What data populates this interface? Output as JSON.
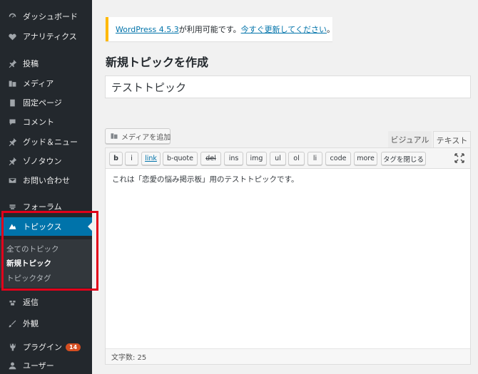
{
  "sidebar": {
    "items": [
      {
        "label": "ダッシュボード",
        "icon": "dashboard-icon"
      },
      {
        "label": "アナリティクス",
        "icon": "analytics-icon"
      },
      {
        "label": "投稿",
        "icon": "pin-icon"
      },
      {
        "label": "メディア",
        "icon": "media-icon"
      },
      {
        "label": "固定ページ",
        "icon": "page-icon"
      },
      {
        "label": "コメント",
        "icon": "comment-icon"
      },
      {
        "label": "グッド＆ニュー",
        "icon": "pin-icon"
      },
      {
        "label": "ゾノタウン",
        "icon": "pin-icon"
      },
      {
        "label": "お問い合わせ",
        "icon": "mail-icon"
      },
      {
        "label": "フォーラム",
        "icon": "forum-icon"
      },
      {
        "label": "トピックス",
        "icon": "topics-icon"
      },
      {
        "label": "返信",
        "icon": "reply-icon"
      },
      {
        "label": "外観",
        "icon": "appearance-icon"
      },
      {
        "label": "プラグイン",
        "icon": "plugin-icon",
        "badge": "14"
      },
      {
        "label": "ユーザー",
        "icon": "user-icon"
      }
    ],
    "submenu": [
      "全てのトピック",
      "新規トピック",
      "トピックタグ"
    ]
  },
  "notice": {
    "link_version": "WordPress 4.5.3",
    "text": " が利用可能です。",
    "link_update": "今すぐ更新してください",
    "end": "。"
  },
  "page_title": "新規トピックを作成",
  "title_input_value": "テストトピック",
  "add_media_label": "メディアを追加",
  "tabs": {
    "visual": "ビジュアル",
    "text": "テキスト"
  },
  "toolbar": [
    "b",
    "i",
    "link",
    "b-quote",
    "del",
    "ins",
    "img",
    "ul",
    "ol",
    "li",
    "code",
    "more",
    "タグを閉じる"
  ],
  "editor_content": "これは「恋愛の悩み掲示板」用のテストトピックです。",
  "word_count": "文字数: 25",
  "colors": {
    "sidebar": "#23282d",
    "current": "#0073aa",
    "notice_border": "#ffb900",
    "highlight": "#e2001a",
    "badge": "#d54e21"
  }
}
